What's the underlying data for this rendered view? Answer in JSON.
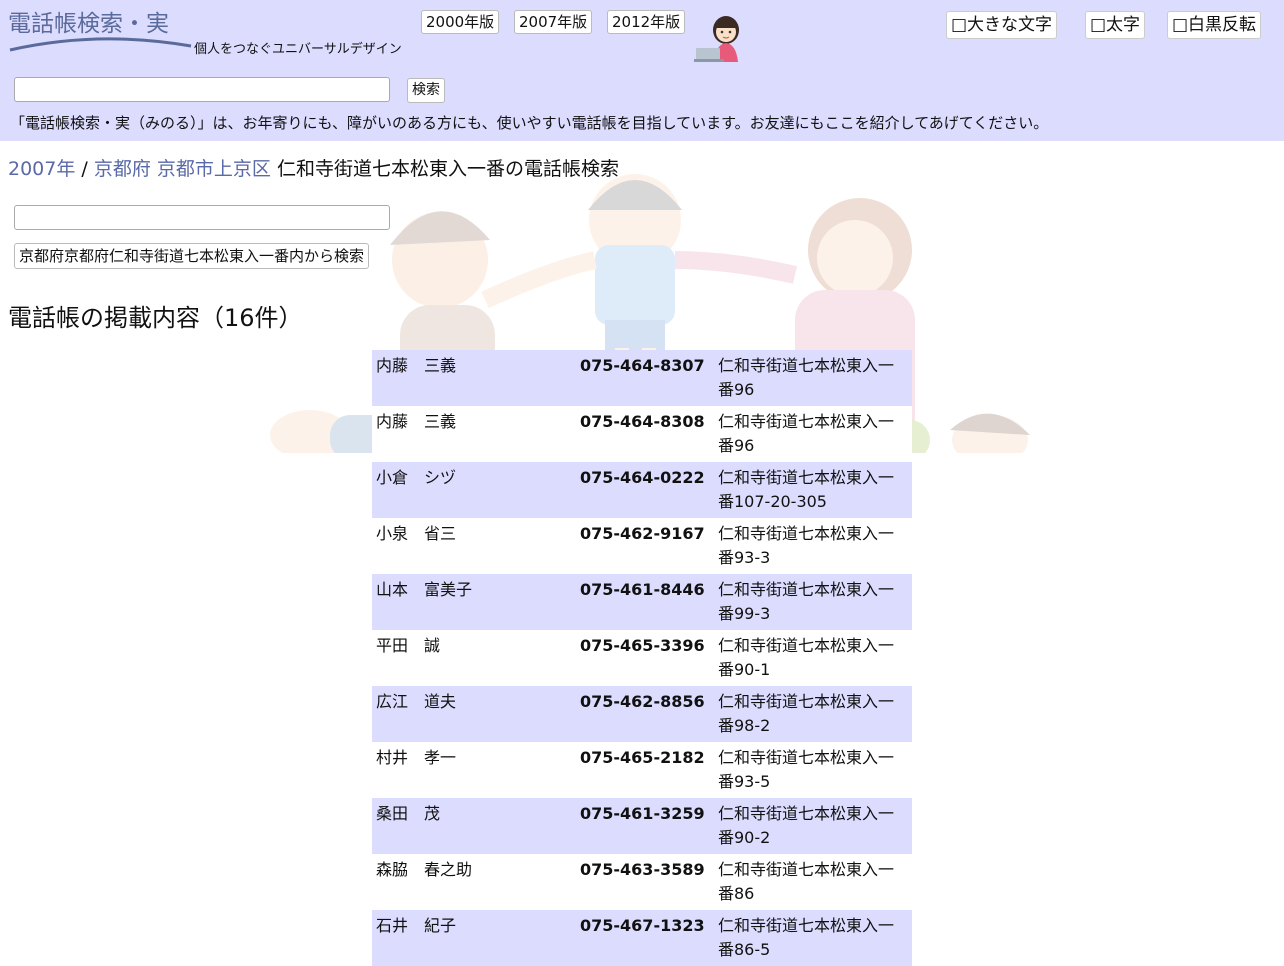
{
  "header": {
    "logo_text": "電話帳検索・実",
    "tagline": "個人をつなぐユニバーサルデザイン",
    "versions": [
      "2000年版",
      "2007年版",
      "2012年版"
    ],
    "options": [
      "□大きな文字",
      "□太字",
      "□白黒反転"
    ],
    "search_button": "検索",
    "intro": "「電話帳検索・実（みのる）」は、お年寄りにも、障がいのある方にも、使いやすい電話帳を目指しています。お友達にもここを紹介してあげてください。"
  },
  "breadcrumb": {
    "year": "2007年",
    "separator": " / ",
    "prefecture": "京都府",
    "city": "京都市上京区",
    "current": "仁和寺街道七本松東入一番の電話帳検索"
  },
  "local_search": {
    "button": "京都府京都府仁和寺街道七本松東入一番内から検索"
  },
  "section_title": "電話帳の掲載内容（16件）",
  "listings": [
    {
      "name": "内藤　三義",
      "phone": "075-464-8307",
      "address": "仁和寺街道七本松東入一番96"
    },
    {
      "name": "内藤　三義",
      "phone": "075-464-8308",
      "address": "仁和寺街道七本松東入一番96"
    },
    {
      "name": "小倉　シヅ",
      "phone": "075-464-0222",
      "address": "仁和寺街道七本松東入一番107-20-305"
    },
    {
      "name": "小泉　省三",
      "phone": "075-462-9167",
      "address": "仁和寺街道七本松東入一番93-3"
    },
    {
      "name": "山本　富美子",
      "phone": "075-461-8446",
      "address": "仁和寺街道七本松東入一番99-3"
    },
    {
      "name": "平田　誠",
      "phone": "075-465-3396",
      "address": "仁和寺街道七本松東入一番90-1"
    },
    {
      "name": "広江　道夫",
      "phone": "075-462-8856",
      "address": "仁和寺街道七本松東入一番98-2"
    },
    {
      "name": "村井　孝一",
      "phone": "075-465-2182",
      "address": "仁和寺街道七本松東入一番93-5"
    },
    {
      "name": "桑田　茂",
      "phone": "075-461-3259",
      "address": "仁和寺街道七本松東入一番90-2"
    },
    {
      "name": "森脇　春之助",
      "phone": "075-463-3589",
      "address": "仁和寺街道七本松東入一番86"
    },
    {
      "name": "石井　紀子",
      "phone": "075-467-1323",
      "address": "仁和寺街道七本松東入一番86-5"
    }
  ],
  "colors": {
    "header_bg": "#dcdcff",
    "row_highlight": "#dcdcff",
    "link": "#5a6aa8",
    "logo": "#5a6a9a"
  }
}
